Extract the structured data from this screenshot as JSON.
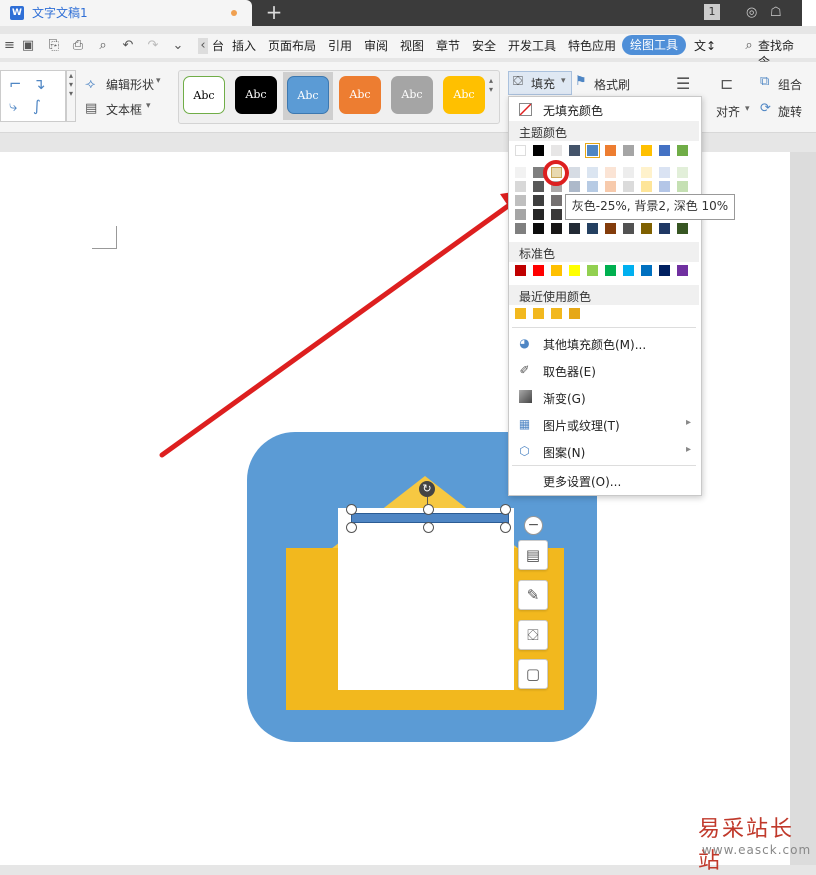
{
  "tabbar": {
    "doc_title": "文字文稿1",
    "plus": "+",
    "page_count": "1"
  },
  "menu": {
    "items": [
      "台",
      "插入",
      "页面布局",
      "引用",
      "审阅",
      "视图",
      "章节",
      "安全",
      "开发工具",
      "特色应用"
    ],
    "active": "绘图工具",
    "trailing": "文↕",
    "search": "查找命令..."
  },
  "ribbon": {
    "edit_shape": "编辑形状",
    "text_box": "文本框",
    "style_label": "Abc",
    "fill": "填充",
    "format_painter": "格式刷",
    "align": "对齐",
    "group": "组合",
    "rotate": "旋转"
  },
  "dropdown": {
    "no_fill": "无填充颜色",
    "theme_colors": "主题颜色",
    "standard_colors": "标准色",
    "recent_colors": "最近使用颜色",
    "more_fill": "其他填充颜色(M)...",
    "eyedropper": "取色器(E)",
    "gradient": "渐变(G)",
    "picture_texture": "图片或纹理(T)",
    "pattern": "图案(N)",
    "more_settings": "更多设置(O)..."
  },
  "theme_top_row": [
    "#ffffff",
    "#000000",
    "#e7e6e6",
    "#44546a",
    "#4f86c4",
    "#ed7d31",
    "#a5a5a5",
    "#ffc000",
    "#4472c4",
    "#70ad47"
  ],
  "theme_shades": [
    [
      "#f2f2f2",
      "#7f7f7f",
      "#d0cece",
      "#d6dce4",
      "#dbe5f1",
      "#fbe4d5",
      "#ededed",
      "#fff2cc",
      "#dae3f3",
      "#e2efd9"
    ],
    [
      "#d8d8d8",
      "#595959",
      "#aeaaaa",
      "#adb9ca",
      "#b7cbe4",
      "#f7caac",
      "#dbdbdb",
      "#fee599",
      "#b4c6e7",
      "#c5e0b3"
    ],
    [
      "#bfbfbf",
      "#3f3f3f",
      "#757171",
      "#8496b0",
      "#95b3d7",
      "#f4b183",
      "#c9c9c9",
      "#ffd966",
      "#8eaadb",
      "#a8d08d"
    ],
    [
      "#a5a5a5",
      "#262626",
      "#3a3838",
      "#323f4f",
      "#366092",
      "#c55a11",
      "#7b7b7b",
      "#bf8f00",
      "#2f5496",
      "#538135"
    ],
    [
      "#7f7f7f",
      "#0c0c0c",
      "#171616",
      "#222a35",
      "#244061",
      "#833c0b",
      "#525252",
      "#7f6000",
      "#1f3864",
      "#375623"
    ]
  ],
  "standard_row": [
    "#c00000",
    "#ff0000",
    "#ffc000",
    "#ffff00",
    "#92d050",
    "#00b050",
    "#00b0f0",
    "#0070c0",
    "#002060",
    "#7030a0"
  ],
  "recent_row": [
    "#f2b81e",
    "#f2b81e",
    "#f2b81e",
    "#e6a817"
  ],
  "tooltip": "灰色-25%, 背景2, 深色 10%",
  "watermark": {
    "cn": "易采站长站",
    "url": "www.easck.com"
  }
}
